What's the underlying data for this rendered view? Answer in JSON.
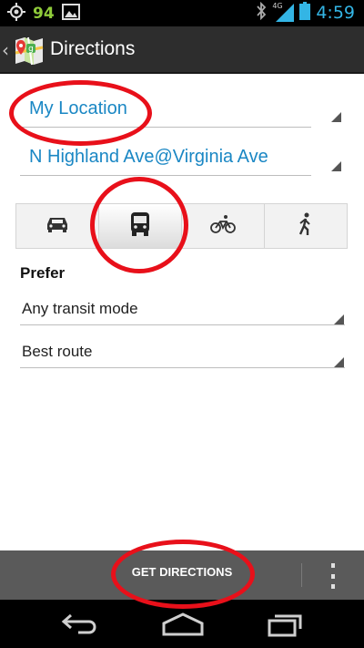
{
  "status_bar": {
    "notification_count": "94",
    "network_label": "4G",
    "time": "4:59",
    "icons": [
      "gps-icon",
      "image-notification-icon",
      "bluetooth-icon",
      "signal-icon",
      "battery-icon"
    ]
  },
  "action_bar": {
    "title": "Directions",
    "app_icon": "maps-app-icon"
  },
  "route": {
    "start": "My Location",
    "destination": "N Highland Ave@Virginia Ave"
  },
  "travel_modes": [
    {
      "name": "car",
      "icon": "car-icon",
      "selected": false
    },
    {
      "name": "transit",
      "icon": "bus-icon",
      "selected": true
    },
    {
      "name": "bike",
      "icon": "bicycle-icon",
      "selected": false
    },
    {
      "name": "walk",
      "icon": "walking-icon",
      "selected": false
    }
  ],
  "prefer": {
    "label": "Prefer",
    "transit_mode": "Any transit mode",
    "route_option": "Best route"
  },
  "bottom_bar": {
    "action_label": "GET DIRECTIONS",
    "overflow_icon": "overflow-menu-icon"
  },
  "nav_bar": {
    "icons": [
      "back-icon",
      "home-icon",
      "recent-apps-icon"
    ]
  },
  "colors": {
    "accent": "#1a87c4",
    "status_time": "#33b5e5",
    "annotation": "#e8101a",
    "action_bar": "#2d2d2d",
    "bottom_bar": "#5a5a5a"
  }
}
